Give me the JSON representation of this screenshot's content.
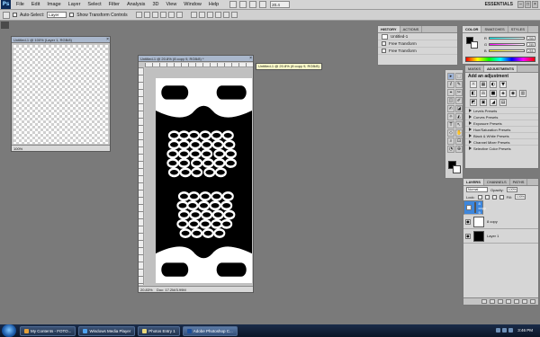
{
  "app": {
    "logo": "Ps",
    "menu": [
      "File",
      "Edit",
      "Image",
      "Layer",
      "Select",
      "Filter",
      "Analysis",
      "3D",
      "View",
      "Window",
      "Help"
    ],
    "zoom_field": "20.4",
    "workspace": "ESSENTIALS",
    "window_controls": [
      "–",
      "□",
      "×"
    ]
  },
  "options": {
    "auto_select_label": "Auto-Select:",
    "auto_select_value": "Layer",
    "show_transform_label": "Show Transform Controls"
  },
  "doc1": {
    "title": "Untitled-1 @ 100% (Layer 1, RGB/8)",
    "zoom": "100%"
  },
  "doc2": {
    "title": "Untitled-1 @ 20.8% (8 copy 9, RGB/8) *",
    "zoom": "20.83%",
    "status": "Doc: 17.2M/3.99M",
    "tooltip": "Untitled-1 @ 20.8% (8 copy 9, RGB/8)"
  },
  "history": {
    "tabs": [
      "HISTORY",
      "ACTIONS"
    ],
    "rows": [
      "Untitled-1",
      "Free Transform",
      "Free Transform"
    ]
  },
  "color": {
    "tabs": [
      "COLOR",
      "SWATCHES",
      "STYLES"
    ],
    "channels": [
      {
        "label": "R",
        "value": "255",
        "track": "linear-gradient(90deg,#0ff,#fff)"
      },
      {
        "label": "G",
        "value": "255",
        "track": "linear-gradient(90deg,#f0f,#fff)"
      },
      {
        "label": "B",
        "value": "255",
        "track": "linear-gradient(90deg,#ff0,#fff)"
      }
    ],
    "foreground": "#000000",
    "background": "#ffffff"
  },
  "adjustments": {
    "tabs": [
      "MASKS",
      "ADJUSTMENTS"
    ],
    "title": "Add an adjustment",
    "icon_row1": [
      "☼",
      "▦",
      "◐",
      "▼"
    ],
    "icon_row2": [
      "◧",
      "⚖",
      "■",
      "◈",
      "◉",
      "▥"
    ],
    "icon_row3": [
      "◩",
      "▣",
      "◢",
      "▤"
    ],
    "presets": [
      "Levels Presets",
      "Curves Presets",
      "Exposure Presets",
      "Hue/Saturation Presets",
      "Black & White Presets",
      "Channel Mixer Presets",
      "Selective Color Presets"
    ]
  },
  "tools": {
    "glyphs": [
      "▸",
      "⬚",
      "ℓ",
      "✎",
      "⌖",
      "✂",
      "◫",
      "✐",
      "✍",
      "◪",
      "✧",
      "◭",
      "T",
      "↖",
      "◇",
      "✋",
      "⌕",
      "⊡",
      "◔",
      "⊕"
    ]
  },
  "layers": {
    "tabs": [
      "LAYERS",
      "CHANNELS",
      "PATHS"
    ],
    "blend_mode": "Normal",
    "opacity_label": "Opacity:",
    "opacity": "100%",
    "lock_label": "Lock:",
    "fill_label": "Fill:",
    "fill": "100%",
    "rows": [
      {
        "name": "8 copy 9",
        "selected": true,
        "thumb": "#ffffff"
      },
      {
        "name": "8 copy",
        "selected": false,
        "thumb": "#ffffff"
      },
      {
        "name": "Layer 1",
        "selected": false,
        "thumb": "#000000"
      }
    ]
  },
  "taskbar": {
    "items": [
      {
        "label": "My Contents - FOTO...",
        "color": "#e4a03a",
        "active": false
      },
      {
        "label": "Windows Media Player",
        "color": "#4fa3f0",
        "active": false
      },
      {
        "label": "Photos Entry 1",
        "color": "#e8d77a",
        "active": false
      },
      {
        "label": "Adobe Photoshop C...",
        "color": "#1d4e9a",
        "active": true
      }
    ],
    "clock": "3:46 PM"
  }
}
